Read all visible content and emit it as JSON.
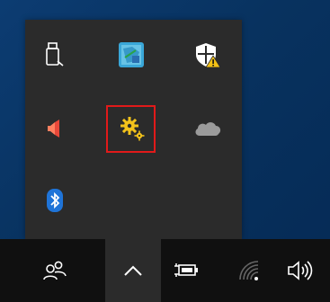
{
  "flyout": {
    "icons": [
      {
        "name": "usb-drive-icon"
      },
      {
        "name": "app-window-icon"
      },
      {
        "name": "security-warning-icon"
      },
      {
        "name": "speaker-muted-icon"
      },
      {
        "name": "gear-settings-icon",
        "highlighted": true
      },
      {
        "name": "onedrive-cloud-icon"
      },
      {
        "name": "bluetooth-icon"
      }
    ]
  },
  "taskbar": {
    "items": [
      {
        "name": "people-icon"
      },
      {
        "name": "show-hidden-icons-chevron"
      },
      {
        "name": "battery-charging-icon"
      },
      {
        "name": "wifi-icon"
      },
      {
        "name": "volume-icon"
      }
    ]
  },
  "colors": {
    "flyout_bg": "#2b2b2b",
    "taskbar_bg": "#101010",
    "highlight": "#e11a1a",
    "icon_white": "#ffffff",
    "gear_yellow": "#f2c21b",
    "bluetooth_blue": "#1f74d8"
  }
}
